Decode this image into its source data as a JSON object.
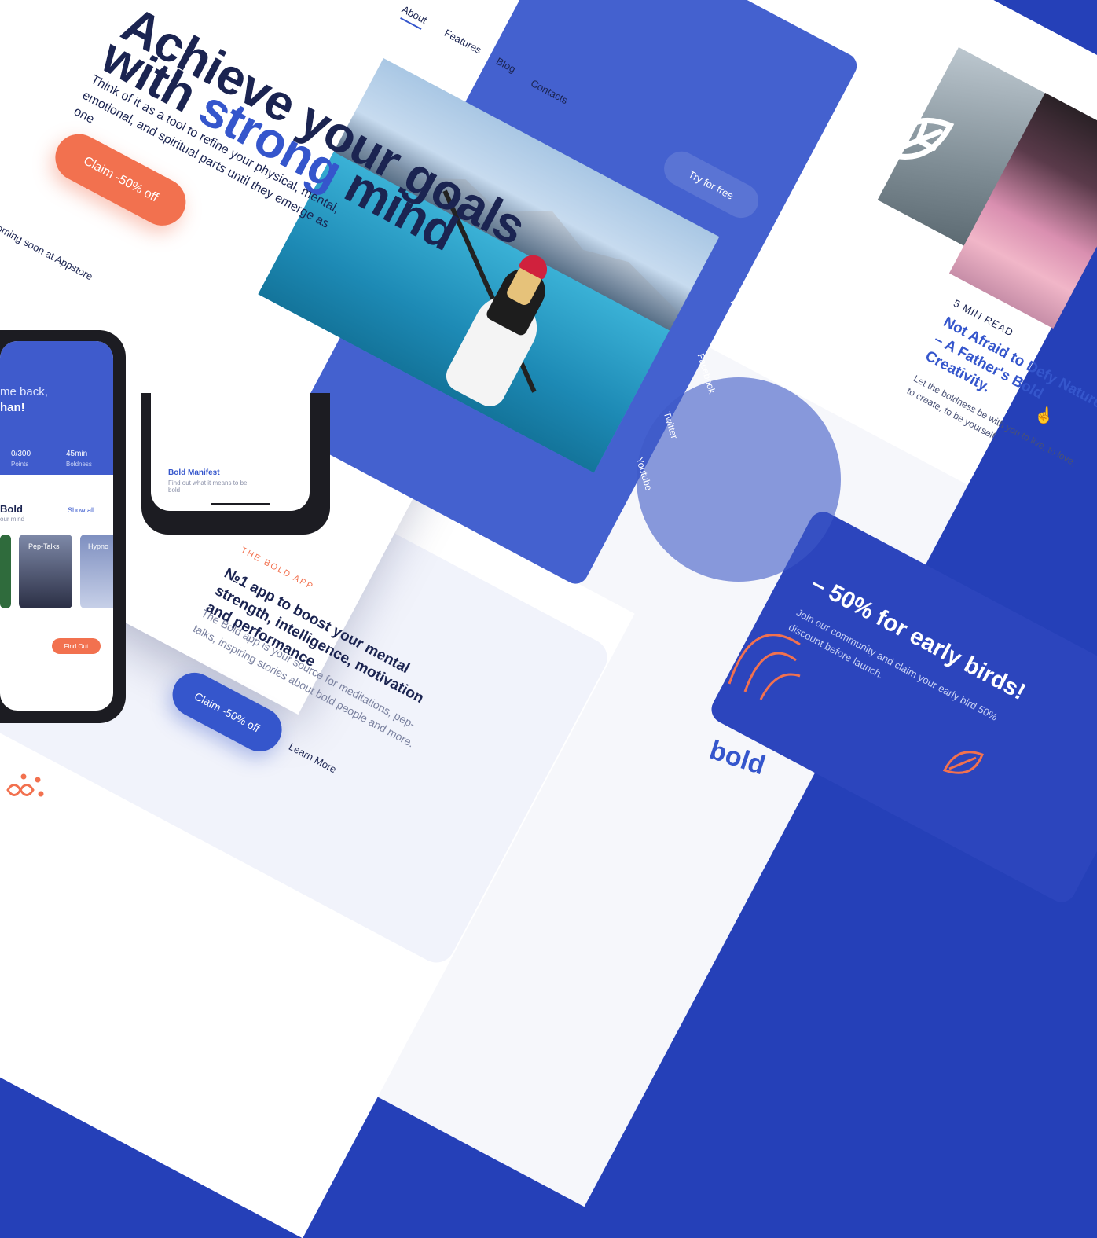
{
  "hero": {
    "title_line1": "Achieve your goals",
    "title_line2_prefix": "with ",
    "title_line2_accent": "strong",
    "title_line2_suffix": " mind",
    "description": "Think of it as a tool  to refine  your physical, mental, emotional, and spiritual parts until they emerge as one",
    "cta_label": "Claim -50% off",
    "appstore_note": "oming soon at Appstore"
  },
  "nav": {
    "items": [
      {
        "label": "About"
      },
      {
        "label": "Features"
      },
      {
        "label": "Blog"
      },
      {
        "label": "Contacts"
      }
    ]
  },
  "side_card": {
    "try_label": "Try for free",
    "social": [
      {
        "label": "Pinterest"
      },
      {
        "label": "Facebook"
      },
      {
        "label": "Twitter"
      },
      {
        "label": "Youtube"
      }
    ]
  },
  "app": {
    "greeting_line1": "me back,",
    "greeting_line2": "han!",
    "points_value": "0/300",
    "points_label": "Points",
    "boldness_value": "45min",
    "boldness_label": "Boldness",
    "section_title": "Bold",
    "section_sub": "our mind",
    "show_all": "Show all",
    "cards": [
      {
        "label": "Pep-Talks"
      },
      {
        "label": "Hypno"
      }
    ],
    "find_out": "Find Out"
  },
  "phone2": {
    "title": "Bold Manifest",
    "desc": "Find out what it means to be bold"
  },
  "bold_app": {
    "eyebrow": "THE BOLD APP",
    "title": "№1 app to boost your mental strength, intelligence, motivation and performance",
    "description": "The Bold app is your source for meditations, pep-talks, inspiring stories about bold people and more.",
    "cta_label": "Claim -50% off",
    "learn_more": "Learn More"
  },
  "article": {
    "read_time": "5 MIN READ",
    "title": "Not Afraid to Defy Nature – A Father's Bold Creativity.",
    "excerpt": "Let the boldness be with you to live, to love, to create, to be yourself."
  },
  "promo": {
    "title": "– 50% for early birds!",
    "text": "Join our community and claim your early bird 50% discount before launch."
  },
  "brand": {
    "logo_text": "bold",
    "accent": "#f2714f",
    "primary": "#2540b8"
  }
}
